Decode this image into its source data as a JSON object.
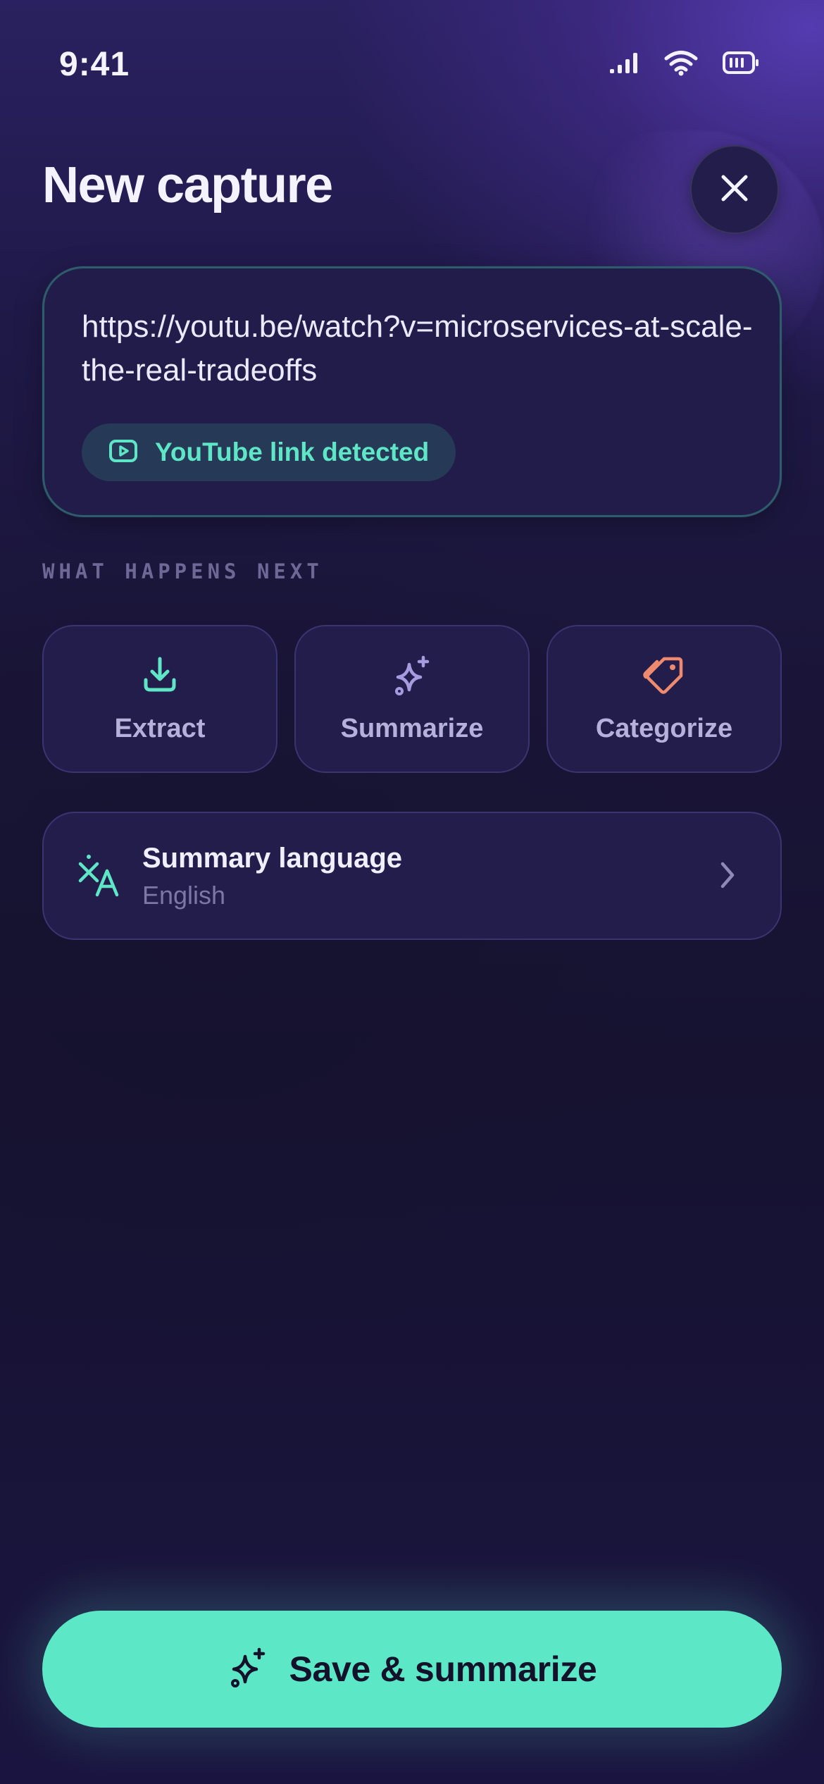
{
  "status_bar": {
    "time": "9:41",
    "icons": [
      "cellular-signal-icon",
      "wifi-icon",
      "battery-icon"
    ]
  },
  "header": {
    "title": "New capture",
    "close_icon": "close-icon"
  },
  "url_card": {
    "url": "https://youtu.be/watch?v=microservices-at-scale-the-real-tradeoffs",
    "detection": {
      "icon": "youtube-play-icon",
      "label": "YouTube link detected"
    }
  },
  "next_section": {
    "label": "WHAT HAPPENS NEXT",
    "tiles": [
      {
        "icon": "download-icon",
        "label": "Extract",
        "icon_color": "#5ee6c6"
      },
      {
        "icon": "sparkles-icon",
        "label": "Summarize",
        "icon_color": "#a79be0"
      },
      {
        "icon": "tags-icon",
        "label": "Categorize",
        "icon_color": "#f08a6e"
      }
    ]
  },
  "language": {
    "icon": "translate-icon",
    "title": "Summary language",
    "value": "English",
    "chevron": "chevron-right-icon"
  },
  "primary_action": {
    "icon": "sparkles-icon",
    "label": "Save & summarize"
  },
  "colors": {
    "accent_mint": "#5ce8c6",
    "background_dark": "#161230",
    "card": "#231d4c",
    "card_border": "#3a3470",
    "orange_accent": "#f08a6e",
    "purple_accent": "#a79be0"
  }
}
